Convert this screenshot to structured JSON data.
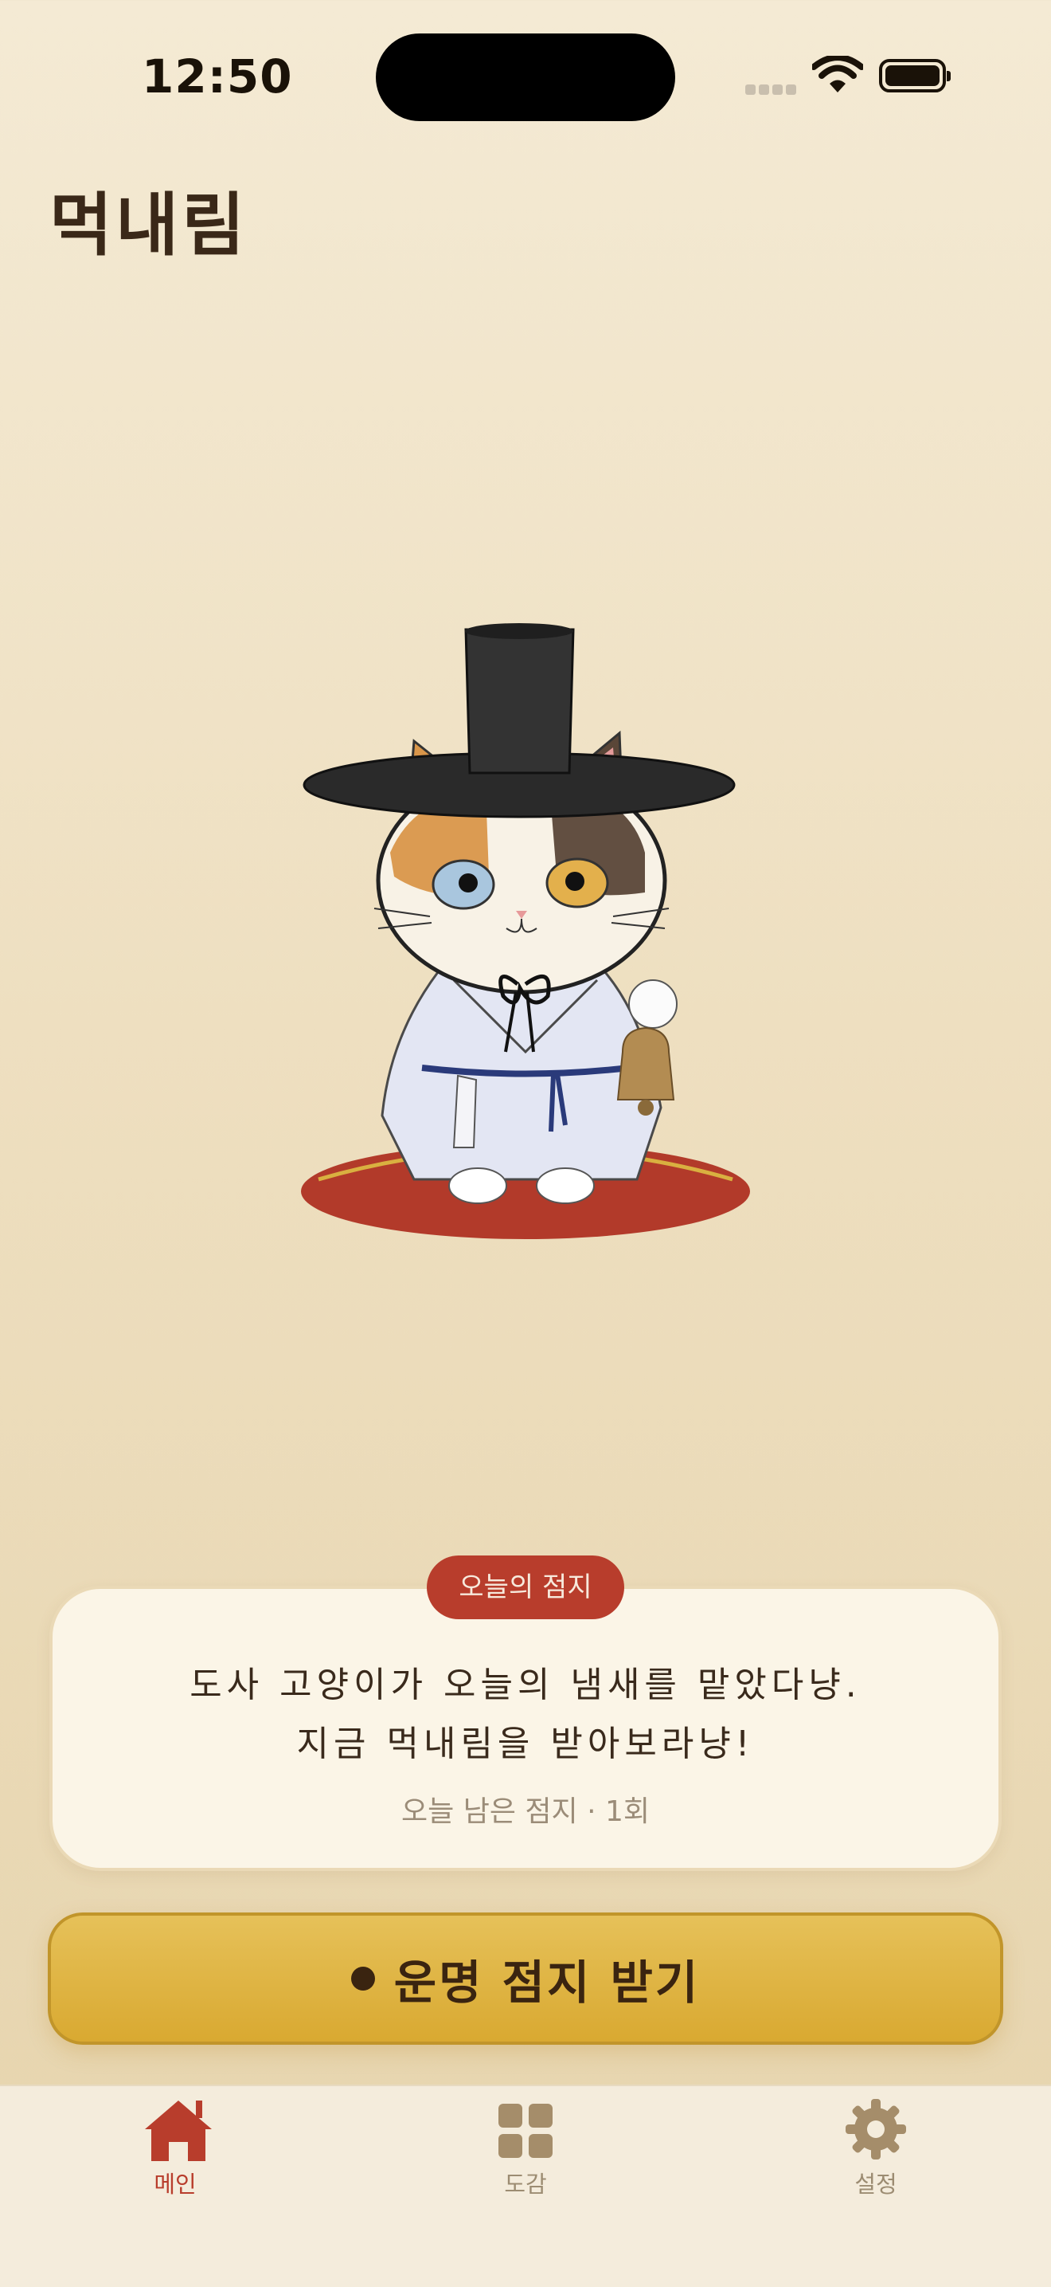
{
  "status_bar": {
    "time": "12:50"
  },
  "header": {
    "title": "먹내림"
  },
  "fortune_card": {
    "badge": "오늘의 점지",
    "message_line1": "도사 고양이가 오늘의 냄새를 맡았다냥.",
    "message_line2": "지금 먹내림을 받아보라냥!",
    "remaining": "오늘 남은 점지 · 1회"
  },
  "cta": {
    "label": "운명 점지 받기"
  },
  "tab_bar": {
    "items": [
      {
        "label": "메인",
        "icon": "house-icon",
        "active": true
      },
      {
        "label": "도감",
        "icon": "grid-icon",
        "active": false
      },
      {
        "label": "설정",
        "icon": "gear-icon",
        "active": false
      }
    ]
  },
  "colors": {
    "accent_red": "#b83d2c",
    "cta_gold": "#dcb040",
    "background": "#f1e5cb"
  }
}
